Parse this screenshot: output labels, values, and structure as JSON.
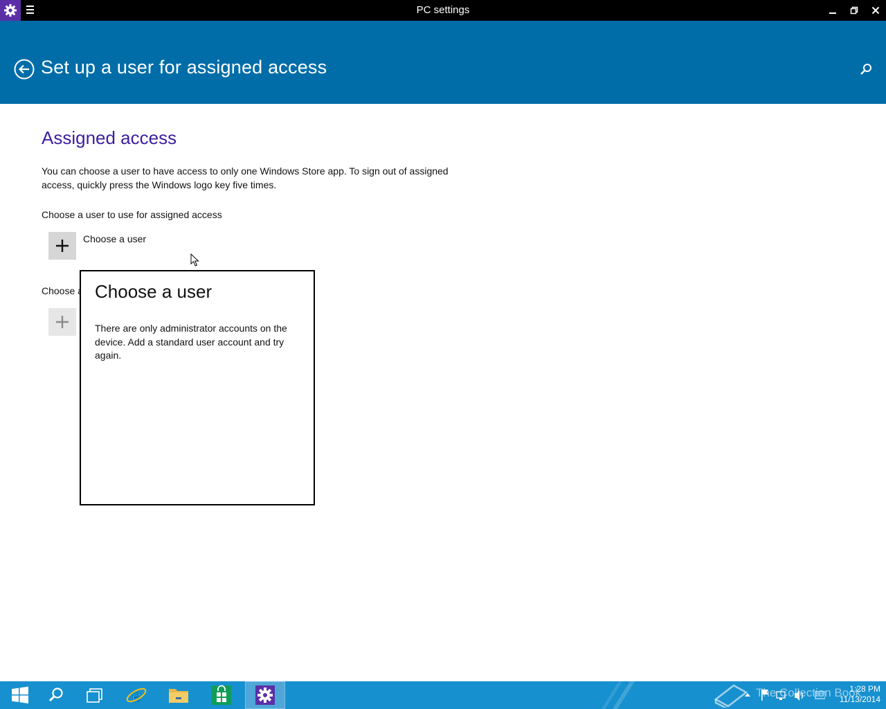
{
  "window": {
    "title": "PC settings"
  },
  "header": {
    "page_title": "Set up a user for assigned access"
  },
  "content": {
    "section_title": "Assigned access",
    "description": "You can choose a user to have access to only one Windows Store app. To sign out of assigned access, quickly press the Windows logo key five times.",
    "choose_user_label": "Choose a user to use for assigned access",
    "choose_user_button": "Choose a user",
    "choose_app_label_partial": "Choose a"
  },
  "flyout": {
    "title": "Choose a user",
    "message": "There are only administrator accounts on the device. Add a standard user account and try again."
  },
  "taskbar": {
    "items": [
      "start-icon",
      "search-icon",
      "task-view-icon",
      "internet-explorer-icon",
      "file-explorer-icon",
      "store-icon",
      "settings-icon"
    ],
    "active_item": "settings-icon",
    "watermark": "The Collection Book",
    "clock_time": "1:28 PM",
    "clock_date": "11/13/2014"
  },
  "colors": {
    "header_blue": "#016da8",
    "accent_purple": "#3c1fa0",
    "taskbar_blue": "#1790cf",
    "titlebar_black": "#000000"
  }
}
